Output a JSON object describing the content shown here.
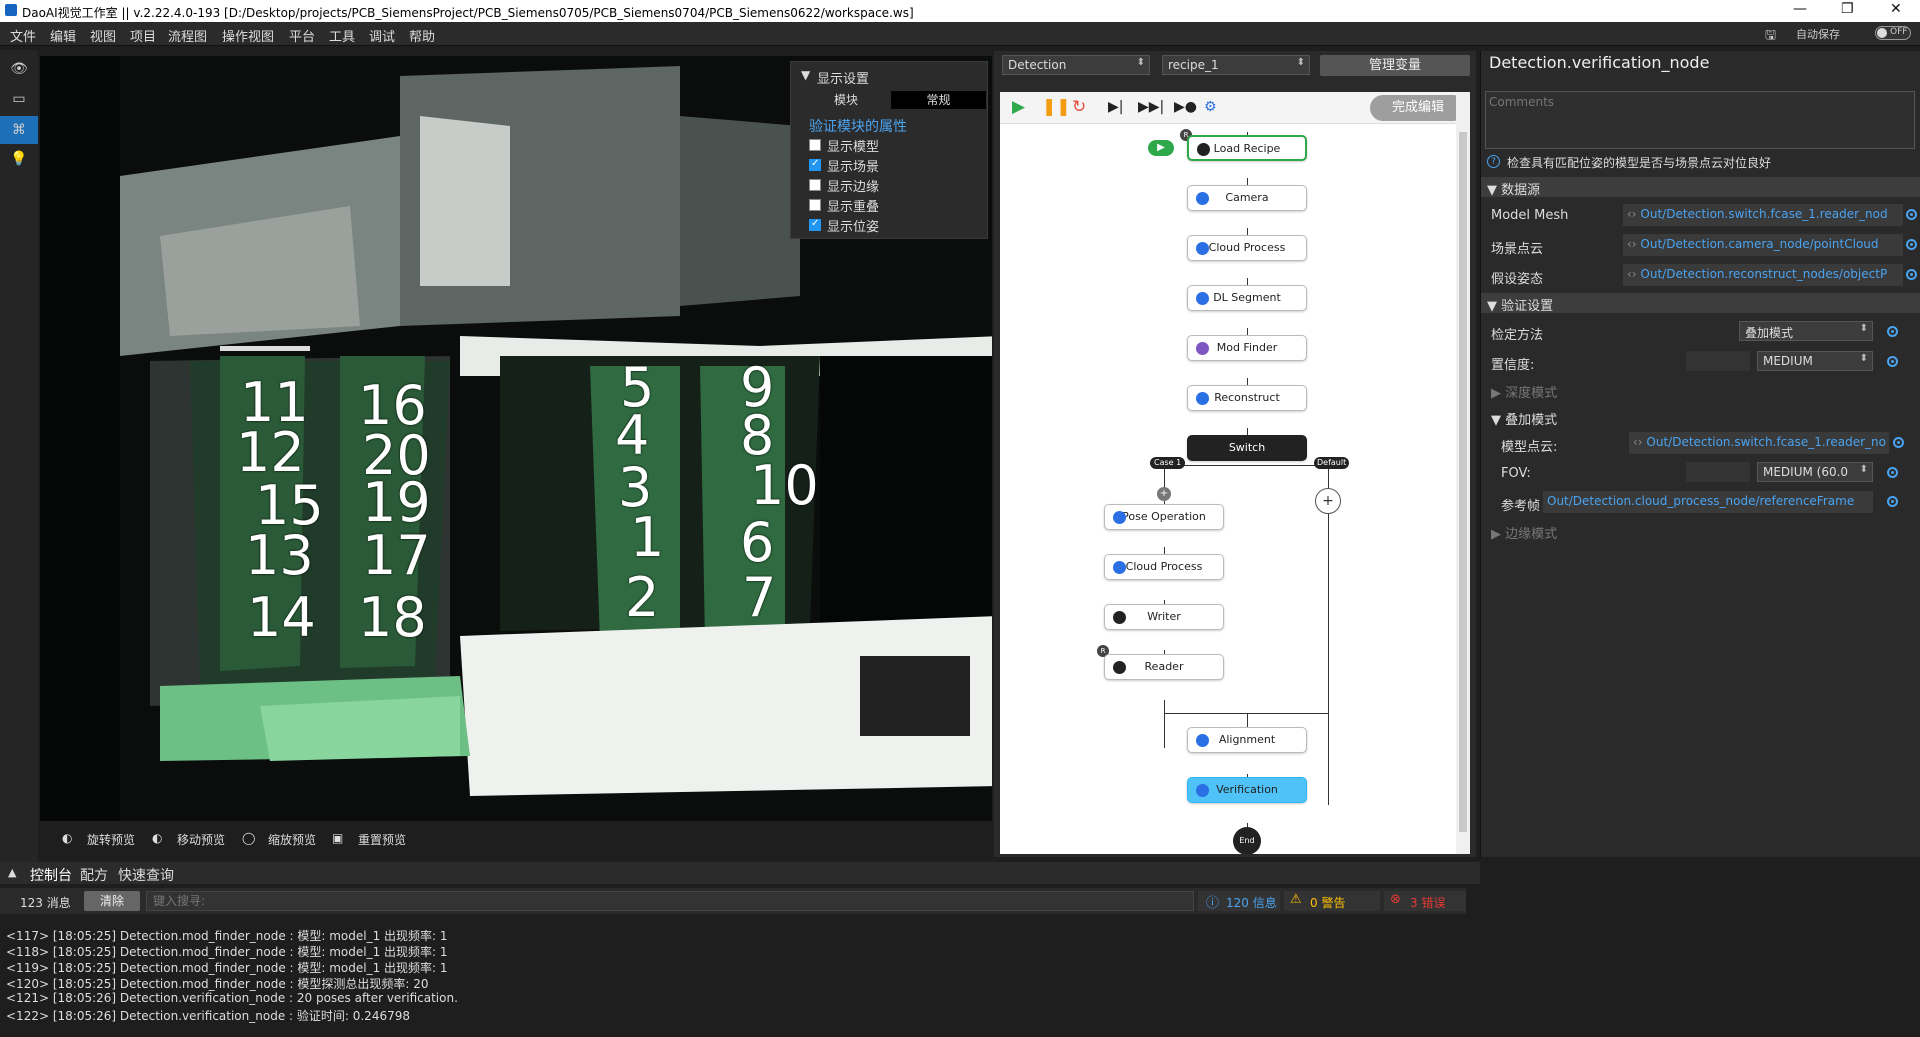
{
  "titlebar": {
    "title": "DaoAI视觉工作室 || v.2.22.4.0-193  [D:/Desktop/projects/PCB_SiemensProject/PCB_Siemens0705/PCB_Siemens0704/PCB_Siemens0622/workspace.ws]"
  },
  "menu": [
    "文件",
    "编辑",
    "视图",
    "项目",
    "流程图",
    "操作视图",
    "平台",
    "工具",
    "调试",
    "帮助"
  ],
  "topright": {
    "autosave": "自动保存",
    "toggle": "OFF"
  },
  "viewer": {
    "numbers": [
      "11",
      "12",
      "15",
      "13",
      "14",
      "16",
      "20",
      "19",
      "17",
      "18",
      "5",
      "4",
      "3",
      "1",
      "2",
      "9",
      "8",
      "10",
      "6",
      "7"
    ],
    "tools": [
      "旋转预览",
      "移动预览",
      "缩放预览",
      "重置预览"
    ]
  },
  "display_settings": {
    "title": "显示设置",
    "tabs": [
      "模块",
      "常规"
    ],
    "section": "验证模块的属性",
    "options": [
      {
        "label": "显示模型",
        "checked": false
      },
      {
        "label": "显示场景",
        "checked": true
      },
      {
        "label": "显示边缘",
        "checked": false
      },
      {
        "label": "显示重叠",
        "checked": false
      },
      {
        "label": "显示位姿",
        "checked": true
      }
    ]
  },
  "flow": {
    "selector1": "Detection",
    "selector2": "recipe_1",
    "manage_button": "管理变量",
    "finish_button": "完成编辑",
    "nodes": {
      "load_recipe": "Load Recipe",
      "camera": "Camera",
      "cloud_process": "Cloud Process",
      "dl_segment": "DL Segment",
      "mod_finder": "Mod Finder",
      "reconstruct": "Reconstruct",
      "switch": "Switch",
      "case1": "Case 1",
      "default": "Default",
      "pose_operation": "Pose Operation",
      "cloud_process2": "Cloud Process",
      "writer": "Writer",
      "reader": "Reader",
      "alignment": "Alignment",
      "verification": "Verification",
      "end": "End"
    }
  },
  "properties": {
    "title": "Detection.verification_node",
    "comments_placeholder": "Comments",
    "description": "检查具有匹配位姿的模型是否与场景点云对位良好",
    "datasource_header": "数据源",
    "model_mesh_label": "Model Mesh",
    "model_mesh_value": "Out/Detection.switch.fcase_1.reader_nod",
    "scene_label": "场景点云",
    "scene_value": "Out/Detection.camera_node/pointCloud",
    "hypo_label": "假设姿态",
    "hypo_value": "Out/Detection.reconstruct_nodes/objectP",
    "verify_header": "验证设置",
    "method_label": "检定方法",
    "method_value": "叠加模式",
    "confidence_label": "置信度:",
    "confidence_value": "MEDIUM",
    "depth_mode": "深度模式",
    "overlay_mode": "叠加模式",
    "model_cloud_label": "模型点云:",
    "model_cloud_value": "Out/Detection.switch.fcase_1.reader_no",
    "fov_label": "FOV:",
    "fov_value": "MEDIUM (60.0",
    "ref_label": "参考帧",
    "ref_value": "Out/Detection.cloud_process_node/referenceFrame",
    "edge_mode": "边缘模式"
  },
  "console": {
    "tabs": [
      "控制台",
      "配方",
      "快速查询"
    ],
    "msg_count": "123 消息",
    "clear_button": "清除",
    "search_placeholder": "键入搜寻:",
    "info": "120 信息",
    "warn": "0 警告",
    "error": "3 错误",
    "lines": [
      "<117> [18:05:25] Detection.mod_finder_node : 模型: model_1 出现频率: 1",
      "<118> [18:05:25] Detection.mod_finder_node : 模型: model_1 出现频率: 1",
      "<119> [18:05:25] Detection.mod_finder_node : 模型: model_1 出现频率: 1",
      "<120> [18:05:25] Detection.mod_finder_node : 模型探测总出现频率: 20",
      "<121> [18:05:26] Detection.verification_node : 20 poses after verification.",
      "<122> [18:05:26] Detection.verification_node : 验证时间: 0.246798"
    ]
  },
  "colors": {
    "accent": "#2196f3",
    "selected_node": "#4fc3f7",
    "link": "#4aa3f0",
    "warning": "#ffc107",
    "error": "#e53935"
  }
}
